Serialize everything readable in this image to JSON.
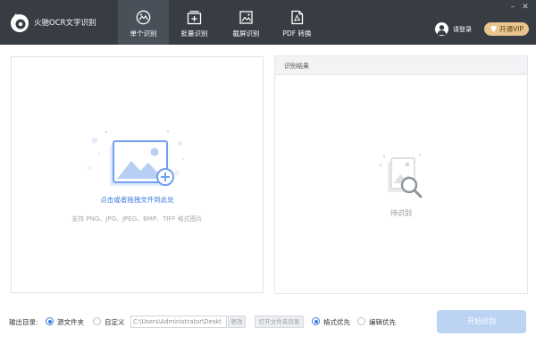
{
  "app": {
    "title": "火驰OCR文字识别"
  },
  "nav": {
    "tabs": [
      {
        "label": "单个识别",
        "icon": "image-scan-icon",
        "active": true
      },
      {
        "label": "批量识别",
        "icon": "batch-add-icon",
        "active": false
      },
      {
        "label": "截屏识别",
        "icon": "screenshot-icon",
        "active": false
      },
      {
        "label": "PDF 转换",
        "icon": "pdf-file-icon",
        "active": false
      }
    ]
  },
  "window": {
    "minimize": "–",
    "close": "✕"
  },
  "account": {
    "login_label": "请登录",
    "vip_label": "开通VIP"
  },
  "dropzone": {
    "link_text": "点击或者拖拽文件到此处",
    "formats_text": "支持 PNG、JPG、JPEG、BMP、TIFF 格式图片"
  },
  "result": {
    "title": "识别结果",
    "waiting_text": "待识别"
  },
  "footer": {
    "output_label": "输出目录:",
    "source_folder_label": "源文件夹",
    "custom_label": "自定义",
    "path_value": "C:\\Users\\Administrator\\Deskt",
    "change_button": "更改",
    "open_folder_button": "打开文件夹目录",
    "format_first_label": "格式优先",
    "edit_first_label": "编辑优先",
    "start_button": "开始识别",
    "output_option": "source_folder",
    "priority_option": "format_first"
  },
  "colors": {
    "header_bg": "#383d44",
    "active_tab_bg": "#4a5059",
    "accent_blue": "#3c7be0",
    "vip_gold": "#e9c48f",
    "start_button_disabled": "#bcd3f4"
  }
}
